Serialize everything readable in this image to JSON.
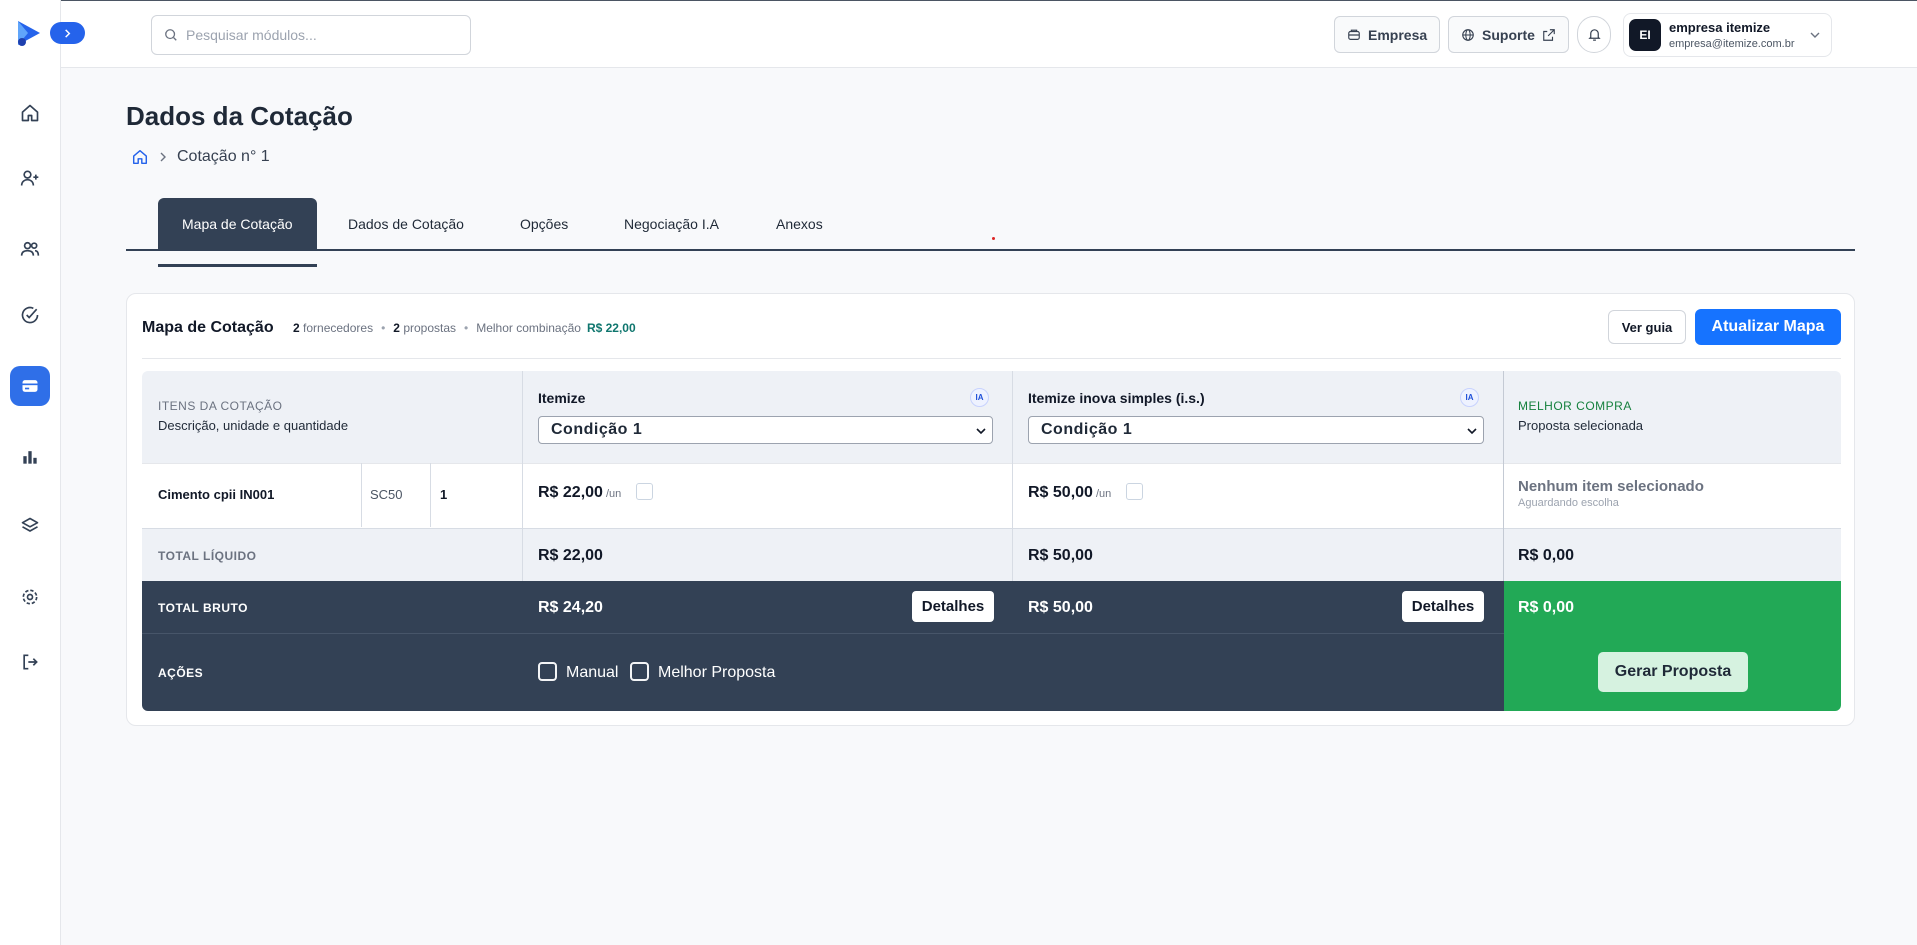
{
  "search": {
    "placeholder": "Pesquisar módulos..."
  },
  "header": {
    "empresa_label": "Empresa",
    "suporte_label": "Suporte",
    "user": {
      "initials": "EI",
      "name": "empresa itemize",
      "email": "empresa@itemize.com.br"
    }
  },
  "page": {
    "title": "Dados da Cotação",
    "breadcrumb": "Cotação n° 1"
  },
  "tabs": [
    "Mapa de Cotação",
    "Dados de Cotação",
    "Opções",
    "Negociação I.A",
    "Anexos"
  ],
  "card": {
    "title": "Mapa de Cotação",
    "fornecedores_count": "2",
    "fornecedores_label": "fornecedores",
    "propostas_count": "2",
    "propostas_label": "propostas",
    "melhor_label": "Melhor combinação",
    "melhor_value": "R$ 22,00",
    "ver_guia": "Ver guia",
    "atualizar": "Atualizar Mapa"
  },
  "table": {
    "itens_header": "ITENS DA COTAÇÃO",
    "itens_sub": "Descrição, unidade e quantidade",
    "suppliers": [
      {
        "name": "Itemize",
        "badge": "IA",
        "condition": "Condição 1",
        "unit_price": "R$ 22,00",
        "unit": "/un",
        "total_liquido": "R$ 22,00",
        "total_bruto": "R$ 24,20"
      },
      {
        "name": "Itemize inova simples (i.s.)",
        "badge": "IA",
        "condition": "Condição 1",
        "unit_price": "R$ 50,00",
        "unit": "/un",
        "total_liquido": "R$ 50,00",
        "total_bruto": "R$ 50,00"
      }
    ],
    "melhor_header": "MELHOR COMPRA",
    "melhor_sub": "Proposta selecionada",
    "item": {
      "description": "Cimento cpii IN001",
      "unit": "SC50",
      "quantity": "1"
    },
    "nenhum": "Nenhum item selecionado",
    "aguardando": "Aguardando escolha",
    "total_liquido_label": "TOTAL LÍQUIDO",
    "total_bruto_label": "TOTAL BRUTO",
    "best_liquido": "R$ 0,00",
    "best_bruto": "R$ 0,00",
    "detalhes": "Detalhes",
    "acoes_label": "AÇÕES",
    "manual_label": "Manual",
    "melhor_proposta_label": "Melhor Proposta",
    "gerar": "Gerar Proposta"
  },
  "colors": {
    "primary": "#1673ff",
    "dark": "#334155",
    "success": "#22a956",
    "active_nav": "#2f6fe8"
  },
  "icons": [
    "logo-icon",
    "chevron-right-icon",
    "home-icon",
    "user-plus-icon",
    "users-icon",
    "check-circle-icon",
    "wallet-icon",
    "bar-chart-icon",
    "layers-icon",
    "settings-icon",
    "logout-icon",
    "search-icon",
    "building-icon",
    "globe-icon",
    "external-link-icon",
    "bell-icon",
    "chevron-down-icon"
  ]
}
